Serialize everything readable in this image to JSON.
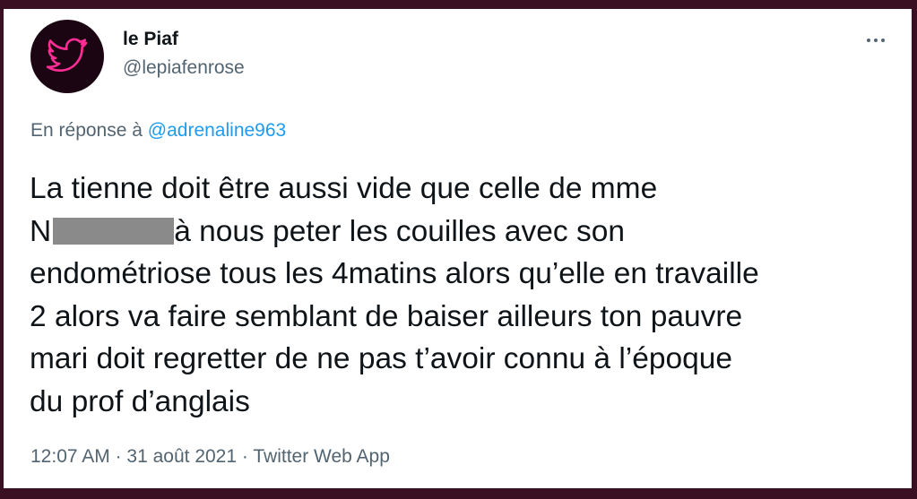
{
  "user": {
    "display_name": "le Piaf",
    "handle": "@lepiafenrose",
    "avatar_icon": "neon-bird-icon",
    "avatar_color": "#ff2d95"
  },
  "more_button": {
    "icon": "more-horizontal-icon"
  },
  "reply": {
    "prefix": "En réponse à",
    "mention": "@adrenaline963"
  },
  "tweet": {
    "lines": [
      "La tienne doit être aussi vide que celle de mme",
      "N",
      "à nous peter les couilles avec son",
      "endométriose tous les 4matins alors qu’elle en travaille",
      "2 alors va faire semblant de baiser ailleurs ton pauvre",
      "mari doit regretter de ne pas t’avoir connu à l’époque",
      "du prof d’anglais"
    ]
  },
  "meta": {
    "time": "12:07 AM",
    "date": "31 août 2021",
    "source": "Twitter Web App",
    "separator": "·"
  }
}
